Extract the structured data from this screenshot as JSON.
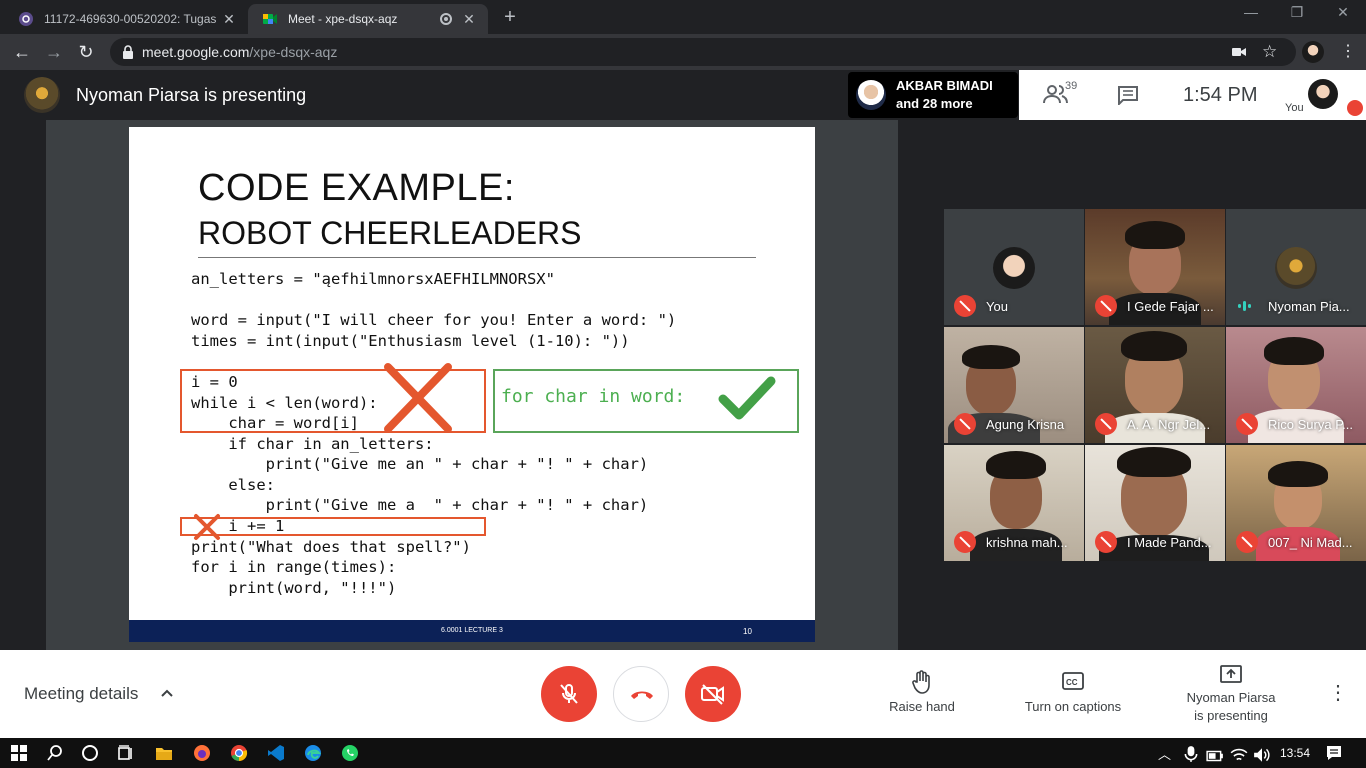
{
  "browser": {
    "tabs": [
      {
        "title": "11172-469630-00520202: Tugas",
        "active": false
      },
      {
        "title": "Meet - xpe-dsqx-aqz",
        "active": true
      }
    ],
    "url_host": "meet.google.com",
    "url_path": "/xpe-dsqx-aqz"
  },
  "meet": {
    "presenting_banner": "Nyoman Piarsa is presenting",
    "participants_chip": {
      "name": "AKBAR BIMADI",
      "more": "and 28 more"
    },
    "participant_count": "39",
    "time": "1:54  PM",
    "self_label": "You"
  },
  "slide": {
    "title": "CODE EXAMPLE:",
    "subtitle": "ROBOT CHEERLEADERS",
    "code_lines": [
      "an_letters = \"ąefhilmnorsxAEFHILMNORSX\"",
      "",
      "word = input(\"I will cheer for you! Enter a word: \")",
      "times = int(input(\"Enthusiasm level (1-10): \"))",
      "",
      "i = 0",
      "while i < len(word):",
      "    char = word[i]",
      "    if char in an_letters:",
      "        print(\"Give me an \" + char + \"! \" + char)",
      "    else:",
      "        print(\"Give me a  \" + char + \"! \" + char)",
      "    i += 1",
      "print(\"What does that spell?\")",
      "for i in range(times):",
      "    print(word, \"!!!\")"
    ],
    "alternative": "for char in word:",
    "footer_course": "6.0001 LECTURE 3",
    "footer_page": "10"
  },
  "participants": [
    {
      "name": "You",
      "muted": true
    },
    {
      "name": "I Gede Fajar ...",
      "muted": true
    },
    {
      "name": "Nyoman Pia...",
      "muted": false
    },
    {
      "name": "Agung Krisna",
      "muted": true
    },
    {
      "name": "A. A. Ngr Jel...",
      "muted": true
    },
    {
      "name": "Rico Surya P...",
      "muted": true
    },
    {
      "name": "krishna mah...",
      "muted": true
    },
    {
      "name": "I Made Pand...",
      "muted": true
    },
    {
      "name": "007_ Ni Mad...",
      "muted": true
    }
  ],
  "controls": {
    "meeting_details": "Meeting details",
    "raise_hand": "Raise hand",
    "captions": "Turn on captions",
    "presenting_line1": "Nyoman Piarsa",
    "presenting_line2": "is presenting"
  },
  "taskbar": {
    "time": "13:54"
  },
  "colors": {
    "mute_red": "#ea4335",
    "slide_footer": "#0c2157",
    "green_check": "#43a047",
    "red_cross": "#e4572e"
  }
}
